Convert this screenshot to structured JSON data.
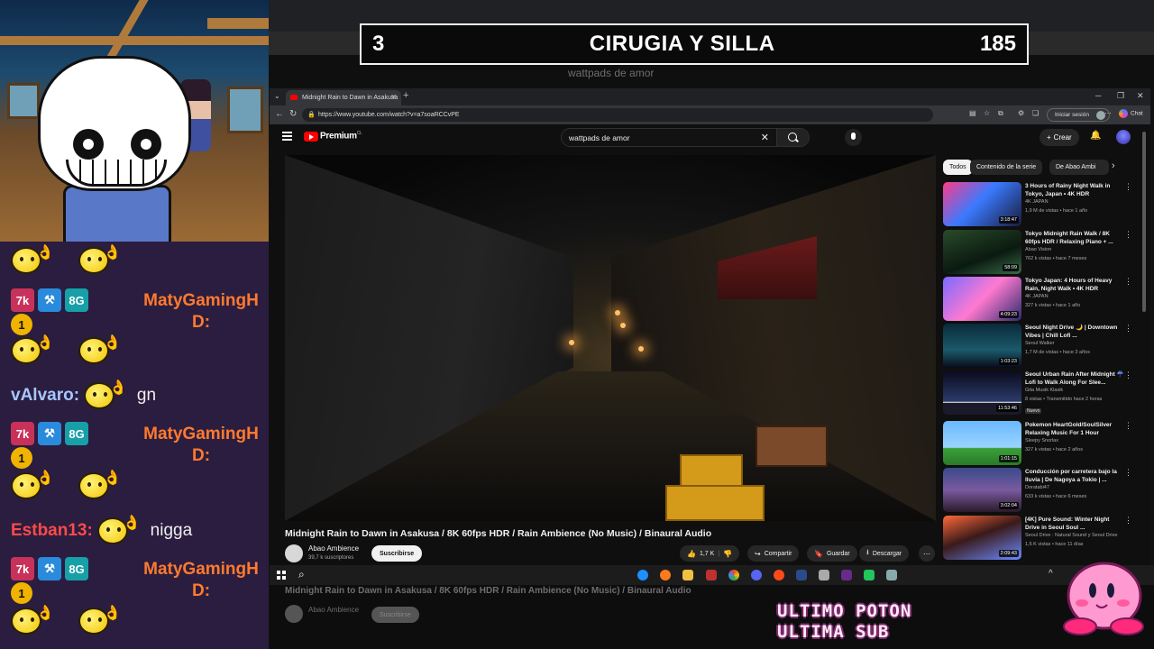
{
  "overlay": {
    "left_number": "3",
    "title": "CIRUGIA Y SILLA",
    "right_number": "185"
  },
  "chat": {
    "lines": [
      {
        "type": "emotes"
      },
      {
        "user": "MatyGamingH",
        "message": "D:",
        "badge_texts": [
          "7k",
          "⚒",
          "8G",
          "1"
        ]
      },
      {
        "type": "emotes"
      },
      {
        "user": "vAlvaro:",
        "message": "gn"
      },
      {
        "user": "MatyGamingH",
        "message": "D:",
        "badge_texts": [
          "7k",
          "⚒",
          "8G",
          "1"
        ]
      },
      {
        "type": "emotes"
      },
      {
        "user": "Estban13:",
        "message": "nigga"
      },
      {
        "user": "MatyGamingH",
        "message": "D:",
        "badge_texts": [
          "7k",
          "⚒",
          "8G",
          "1"
        ]
      },
      {
        "type": "emotes"
      }
    ],
    "user1": "MatyGamingH",
    "user1_msg": "D:",
    "user2": "vAlvaro:",
    "user2_msg": "gn",
    "user3": "Estban13:",
    "user3_msg": "nigga"
  },
  "browser": {
    "tab_title": "Midnight Rain to Dawn in Asakusa",
    "url": "https://www.youtube.com/watch?v=a7soaRCCvPE",
    "signin_label": "Iniciar sesión",
    "chat_label": "Chat"
  },
  "youtube": {
    "brand": "Premium",
    "brand_region": "CL",
    "search_value": "wattpads de amor",
    "create_label": "Crear",
    "video_title": "Midnight Rain to Dawn in Asakusa / 8K 60fps HDR / Rain Ambience (No Music) / Binaural Audio",
    "channel_name": "Abao Ambience",
    "channel_subs": "39,7 k suscriptores",
    "subscribe_label": "Suscribirse",
    "likes": "1,7 K",
    "share_label": "Compartir",
    "save_label": "Guardar",
    "download_label": "Descargar",
    "chips": [
      "Todos",
      "Contenido de la serie",
      "De Abao Ambi"
    ],
    "recommendations": [
      {
        "title": "3 Hours of Rainy Night Walk in Tokyo, Japan • 4K HDR",
        "channel": "4K JAPAN",
        "meta": "1,9 M de vistas • hace 1 año",
        "duration": "3:18:47"
      },
      {
        "title": "Tokyo Midnight Rain Walk / 8K 60fps HDR / Relaxing Piano + ...",
        "channel": "Abao Vision",
        "meta": "762 k vistas • hace 7 meses",
        "duration": "58:09"
      },
      {
        "title": "Tokyo Japan: 4 Hours of Heavy Rain, Night Walk • 4K HDR",
        "channel": "4K JAPAN",
        "meta": "327 k vistas • hace 1 año",
        "duration": "4:09:23"
      },
      {
        "title": "Seoul Night Drive 🌙 | Downtown Vibes | Chill Lofi ...",
        "channel": "Seoul Walker",
        "meta": "1,7 M de vistas • hace 3 años",
        "duration": "1:03:23"
      },
      {
        "title": "Seoul Urban Rain After Midnight ☔ Lofi to Walk Along For Slee...",
        "channel": "Gita Musik Klasik",
        "meta": "8 vistas • Transmitido hace 2 horas",
        "badge": "Nuevo",
        "duration": "11:53:46"
      },
      {
        "title": "Pokemon HeartGold/SoulSilver Relaxing Music For 1 Hour",
        "channel": "Sleepy Snorlax",
        "meta": "327 k vistas • hace 2 años",
        "duration": "1:01:15"
      },
      {
        "title": "Conducción por carretera bajo la lluvia | De Nagoya a Tokio | ...",
        "channel": "Doratabi47",
        "meta": "633 k vistas • hace 6 meses",
        "duration": "3:02:04"
      },
      {
        "title": "[4K] Pure Sound: Winter Night Drive in Seoul Soul ...",
        "channel": "Seoul Drive : Natural Sound y Seoul Drive",
        "meta": "1,6 K vistas • hace 11 días",
        "duration": "2:09:43"
      }
    ]
  },
  "ghost": {
    "search": "wattpads de amor",
    "title": "Midnight Rain to Dawn in Asakusa / 8K 60fps HDR / Rain Ambience (No Music) / Binaural Audio",
    "channel": "Abao Ambience",
    "sub": "Suscribirse"
  },
  "stream_label": {
    "line1": "ULTIMO POTON",
    "line2": "ULTIMA SUB"
  }
}
